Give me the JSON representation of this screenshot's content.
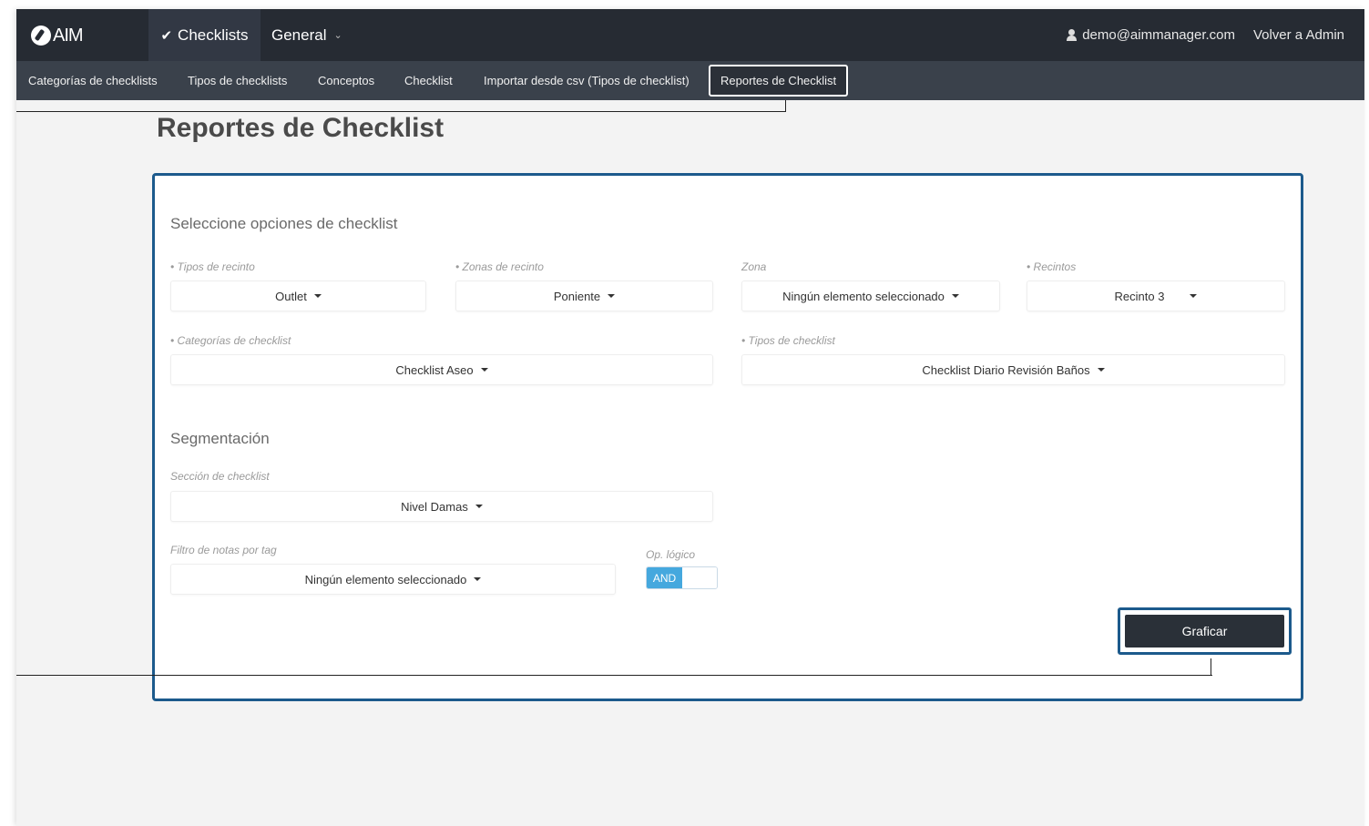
{
  "header": {
    "logo_text": "AIM",
    "nav_checklists": "Checklists",
    "nav_general": "General",
    "user_email": "demo@aimmanager.com",
    "back_to_admin": "Volver a Admin"
  },
  "subnav": {
    "items": [
      {
        "label": "Categorías de checklists"
      },
      {
        "label": "Tipos de checklists"
      },
      {
        "label": "Conceptos"
      },
      {
        "label": "Checklist"
      },
      {
        "label": "Importar desde csv (Tipos de checklist)"
      },
      {
        "label": "Reportes de Checklist"
      }
    ],
    "active": "Reportes de Checklist"
  },
  "page": {
    "title": "Reportes de Checklist"
  },
  "form": {
    "section_title": "Seleccione opciones de checklist",
    "tipos_recinto": {
      "label": "Tipos de recinto",
      "value": "Outlet"
    },
    "zonas_recinto": {
      "label": "Zonas de recinto",
      "value": "Poniente"
    },
    "zona": {
      "label": "Zona",
      "value": "Ningún elemento seleccionado"
    },
    "recintos": {
      "label": "Recintos",
      "value": "Recinto 3"
    },
    "categorias_checklist": {
      "label": "Categorías de checklist",
      "value": "Checklist Aseo"
    },
    "tipos_checklist": {
      "label": "Tipos de checklist",
      "value": "Checklist Diario Revisión Baños"
    }
  },
  "segmentation": {
    "section_title": "Segmentación",
    "seccion_checklist": {
      "label": "Sección de checklist",
      "value": "Nivel Damas"
    },
    "filtro_notas": {
      "label": "Filtro de notas por tag",
      "value": "Ningún elemento seleccionado"
    },
    "op_logico": {
      "label": "Op. lógico",
      "value": "AND"
    }
  },
  "actions": {
    "graficar": "Graficar"
  },
  "colors": {
    "topbar": "#262b33",
    "subnav": "#3a414b",
    "highlight_border": "#1c5a8c",
    "toggle_on": "#45a8de",
    "button": "#2a3038"
  }
}
